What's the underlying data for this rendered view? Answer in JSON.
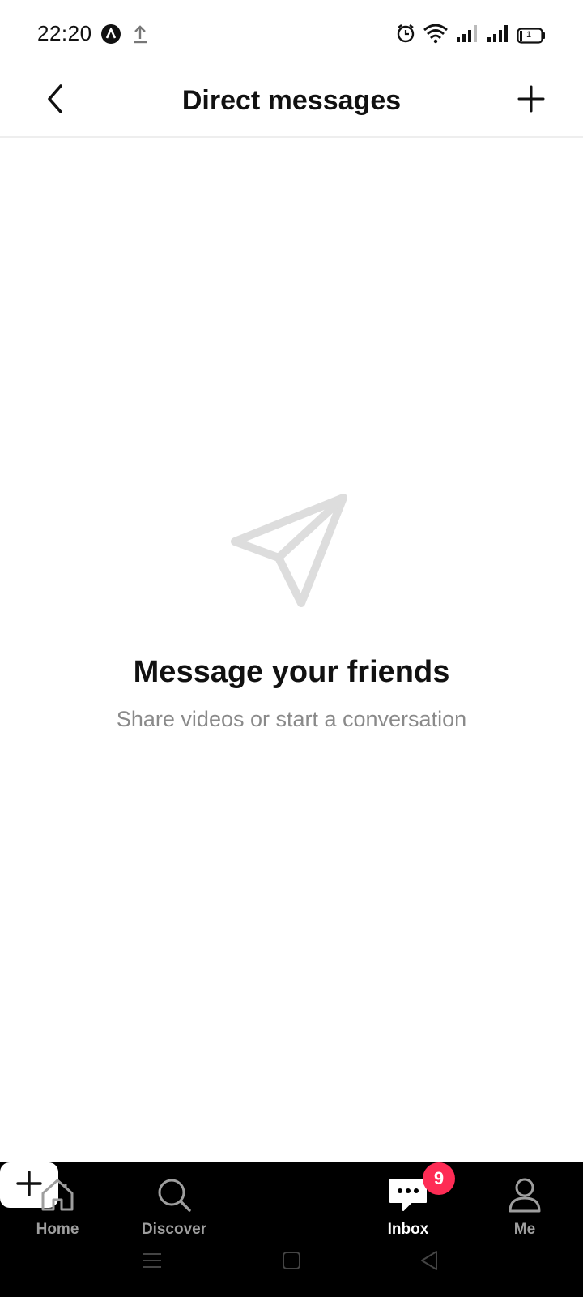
{
  "status_bar": {
    "time": "22:20",
    "battery": "1",
    "icons": [
      "app-notification-icon",
      "upload-icon",
      "alarm-icon",
      "wifi-icon",
      "signal-icon",
      "signal-icon",
      "battery-icon"
    ]
  },
  "header": {
    "title": "Direct messages",
    "back_icon": "chevron-left-icon",
    "add_icon": "plus-icon"
  },
  "empty_state": {
    "icon": "send-icon",
    "title": "Message your friends",
    "subtitle": "Share videos or start a conversation"
  },
  "bottom_nav": {
    "items": [
      {
        "label": "Home",
        "icon": "home-icon",
        "active": false
      },
      {
        "label": "Discover",
        "icon": "search-icon",
        "active": false
      },
      {
        "label": "",
        "icon": "plus-icon",
        "active": false
      },
      {
        "label": "Inbox",
        "icon": "chat-icon",
        "active": true,
        "badge": "9"
      },
      {
        "label": "Me",
        "icon": "profile-icon",
        "active": false
      }
    ]
  },
  "colors": {
    "accent": "#fe2c55",
    "nav_background": "#000000",
    "inactive_label": "#9e9e9e",
    "subtitle": "#8a8a8a"
  }
}
